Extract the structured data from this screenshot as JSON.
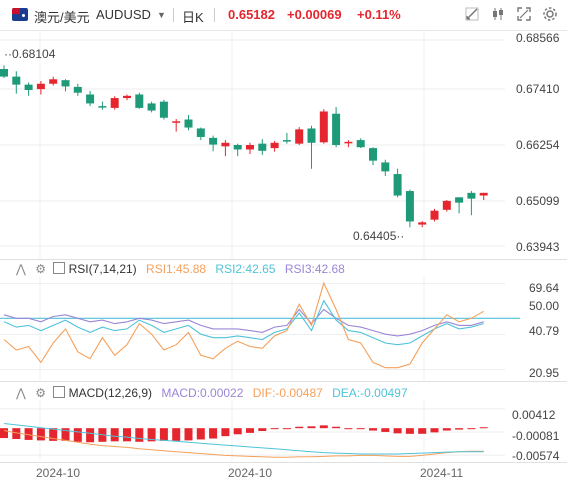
{
  "toolbar": {
    "symbol_cn": "澳元/美元",
    "symbol_code": "AUDUSD",
    "period": "日K",
    "last_price": "0.65182",
    "change": "+0.00069",
    "change_pct": "+0.11%",
    "icons": [
      "flag-au-icon",
      "dropdown-caret-icon",
      "draw-tool-icon",
      "candle-style-icon",
      "indicator-icon",
      "fullscreen-icon",
      "settings-icon"
    ]
  },
  "colors": {
    "up": "#e5262e",
    "down": "#1e9a78",
    "rsi1": "#f5a05a",
    "rsi2": "#4fc3d9",
    "rsi3": "#9b86d6",
    "macd": "#f5a05a",
    "dea": "#4fc3d9",
    "dif": "#f5a05a"
  },
  "price_axis": {
    "labels": [
      "0.68566",
      "0.67410",
      "0.66254",
      "0.65099",
      "0.63943"
    ],
    "high_label": "0.68104",
    "low_label": "0.64405"
  },
  "rsi": {
    "title": "RSI(7,14,21)",
    "rsi1": "RSI1:45.88",
    "rsi2": "RSI2:42.65",
    "rsi3": "RSI3:42.68",
    "axis": [
      "69.64",
      "50.00",
      "40.79",
      "20.95"
    ]
  },
  "macd": {
    "title": "MACD(12,26,9)",
    "macd_v": "MACD:0.00022",
    "dif_v": "DIF:-0.00487",
    "dea_v": "DEA:-0.00497",
    "axis": [
      "0.00412",
      "-0.00081",
      "-0.00574"
    ]
  },
  "time_axis": [
    "2024-10",
    "2024-10",
    "2024-11"
  ],
  "chart_data": [
    {
      "type": "candlestick",
      "title": "AUDUSD 日K",
      "ylim": [
        0.637,
        0.688
      ],
      "series": [
        {
          "name": "AUDUSD",
          "ohlc": [
            [
              0.6795,
              0.6803,
              0.6775,
              0.6778
            ],
            [
              0.6778,
              0.679,
              0.674,
              0.676
            ],
            [
              0.676,
              0.6765,
              0.6735,
              0.6748
            ],
            [
              0.675,
              0.6768,
              0.6738,
              0.6762
            ],
            [
              0.6762,
              0.6778,
              0.6758,
              0.6772
            ],
            [
              0.677,
              0.6772,
              0.6745,
              0.6756
            ],
            [
              0.6755,
              0.6762,
              0.6735,
              0.6742
            ],
            [
              0.6738,
              0.6746,
              0.6712,
              0.6718
            ],
            [
              0.6712,
              0.6722,
              0.6704,
              0.671
            ],
            [
              0.6708,
              0.6734,
              0.6704,
              0.673
            ],
            [
              0.673,
              0.6738,
              0.6725,
              0.6735
            ],
            [
              0.6738,
              0.6742,
              0.6706,
              0.6708
            ],
            [
              0.6718,
              0.6722,
              0.6698,
              0.6702
            ],
            [
              0.6722,
              0.6726,
              0.6682,
              0.6686
            ],
            [
              0.6676,
              0.6683,
              0.6655,
              0.6678
            ],
            [
              0.6682,
              0.6692,
              0.6658,
              0.6664
            ],
            [
              0.6662,
              0.6664,
              0.6636,
              0.6643
            ],
            [
              0.6641,
              0.6646,
              0.6611,
              0.6626
            ],
            [
              0.6622,
              0.6636,
              0.66,
              0.663
            ],
            [
              0.6625,
              0.6628,
              0.66,
              0.6615
            ],
            [
              0.6615,
              0.663,
              0.6605,
              0.6625
            ],
            [
              0.6628,
              0.6638,
              0.6603,
              0.6612
            ],
            [
              0.6618,
              0.6634,
              0.661,
              0.663
            ],
            [
              0.6636,
              0.6652,
              0.6628,
              0.6634
            ],
            [
              0.6628,
              0.6665,
              0.6625,
              0.666
            ],
            [
              0.6662,
              0.6668,
              0.6572,
              0.663
            ],
            [
              0.6631,
              0.6705,
              0.6628,
              0.67
            ],
            [
              0.6695,
              0.671,
              0.662,
              0.6625
            ],
            [
              0.663,
              0.6636,
              0.662,
              0.6632
            ],
            [
              0.6636,
              0.664,
              0.6618,
              0.662
            ],
            [
              0.6618,
              0.662,
              0.658,
              0.659
            ],
            [
              0.6586,
              0.6592,
              0.6556,
              0.6566
            ],
            [
              0.656,
              0.6572,
              0.6508,
              0.6512
            ],
            [
              0.6522,
              0.6525,
              0.6441,
              0.6454
            ],
            [
              0.6447,
              0.6455,
              0.6441,
              0.6452
            ],
            [
              0.6458,
              0.6482,
              0.6454,
              0.6478
            ],
            [
              0.648,
              0.6502,
              0.6476,
              0.65
            ],
            [
              0.6508,
              0.6508,
              0.6472,
              0.6496
            ],
            [
              0.6518,
              0.6522,
              0.6468,
              0.6505
            ],
            [
              0.6512,
              0.6518,
              0.6502,
              0.6518
            ]
          ]
        }
      ]
    },
    {
      "type": "line",
      "title": "RSI(7,14,21)",
      "ylim": [
        15,
        74
      ],
      "series": [
        {
          "name": "RSI1",
          "values": [
            38,
            32,
            34,
            25,
            36,
            44,
            31,
            27,
            39,
            29,
            35,
            47,
            41,
            32,
            35,
            42,
            29,
            27,
            33,
            37,
            34,
            33,
            40,
            43,
            58,
            46,
            70,
            55,
            38,
            36,
            25,
            22,
            22,
            24,
            36,
            44,
            52,
            48,
            50,
            54
          ]
        },
        {
          "name": "RSI2",
          "values": [
            48,
            45,
            46,
            43,
            46,
            49,
            45,
            42,
            45,
            43,
            44,
            49,
            46,
            42,
            44,
            46,
            41,
            39,
            39,
            40,
            39,
            38,
            42,
            44,
            53,
            43,
            60,
            49,
            43,
            42,
            39,
            36,
            35,
            36,
            40,
            44,
            47,
            44,
            45,
            47
          ]
        },
        {
          "name": "RSI3",
          "values": [
            52,
            50,
            50,
            48,
            51,
            52,
            50,
            48,
            49,
            47,
            48,
            50,
            49,
            47,
            48,
            49,
            46,
            44,
            44,
            44,
            43,
            42,
            45,
            46,
            55,
            47,
            55,
            50,
            46,
            45,
            43,
            41,
            40,
            41,
            43,
            46,
            48,
            46,
            46,
            48
          ]
        }
      ]
    },
    {
      "type": "bar",
      "title": "MACD(12,26,9)",
      "ylim": [
        -0.0072,
        0.006
      ],
      "series": [
        {
          "name": "MACD",
          "values": [
            -0.0021,
            -0.0023,
            -0.0025,
            -0.0026,
            -0.0027,
            -0.0027,
            -0.0029,
            -0.003,
            -0.0029,
            -0.0028,
            -0.0028,
            -0.0029,
            -0.0028,
            -0.0027,
            -0.0027,
            -0.0026,
            -0.0024,
            -0.0022,
            -0.0017,
            -0.0013,
            -0.001,
            -0.0006,
            -0.0002,
            -0.0001,
            0.0003,
            0.0004,
            0.0006,
            0.0003,
            -0.0001,
            -0.0002,
            -0.0005,
            -0.0008,
            -0.0011,
            -0.0012,
            -0.0012,
            -0.0009,
            -0.0005,
            -0.0003,
            -0.0001,
            0.0002
          ]
        },
        {
          "name": "DIF",
          "values": [
            -0.0005,
            -0.001,
            -0.0014,
            -0.0018,
            -0.0022,
            -0.0026,
            -0.003,
            -0.0034,
            -0.0037,
            -0.0039,
            -0.0041,
            -0.0044,
            -0.0046,
            -0.0048,
            -0.005,
            -0.0052,
            -0.0054,
            -0.0056,
            -0.0058,
            -0.0059,
            -0.006,
            -0.0061,
            -0.0062,
            -0.0062,
            -0.0061,
            -0.0061,
            -0.006,
            -0.0059,
            -0.0059,
            -0.0058,
            -0.0058,
            -0.0059,
            -0.006,
            -0.006,
            -0.0058,
            -0.0055,
            -0.0052,
            -0.005,
            -0.0049,
            -0.0049
          ]
        },
        {
          "name": "DEA",
          "values": [
            0.001,
            0.0007,
            0.0004,
            0.0001,
            -0.0002,
            -0.0005,
            -0.0008,
            -0.0011,
            -0.0014,
            -0.0017,
            -0.0019,
            -0.0022,
            -0.0024,
            -0.0026,
            -0.0028,
            -0.003,
            -0.0032,
            -0.0034,
            -0.0036,
            -0.0038,
            -0.004,
            -0.0042,
            -0.0044,
            -0.0046,
            -0.0048,
            -0.005,
            -0.0052,
            -0.0053,
            -0.0054,
            -0.0055,
            -0.0055,
            -0.0055,
            -0.0055,
            -0.0054,
            -0.0053,
            -0.0052,
            -0.0051,
            -0.005,
            -0.005,
            -0.005
          ]
        }
      ]
    }
  ]
}
